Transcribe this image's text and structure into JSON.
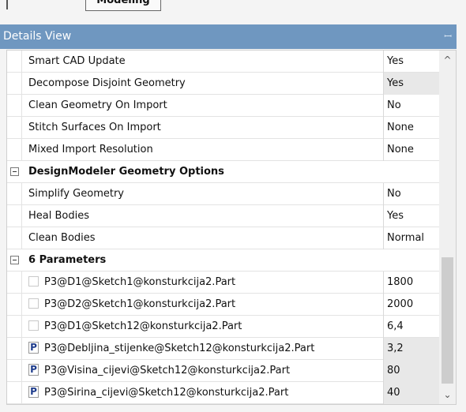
{
  "tabs": {
    "active_label": "Modeling"
  },
  "header": {
    "title": "Details View",
    "pin_glyph": "ꟷ"
  },
  "rows_top": [
    {
      "name": "Smart CAD Update",
      "value": "Yes",
      "highlight": false
    },
    {
      "name": "Decompose Disjoint Geometry",
      "value": "Yes",
      "highlight": true
    },
    {
      "name": "Clean Geometry On Import",
      "value": "No",
      "highlight": false
    },
    {
      "name": "Stitch Surfaces On Import",
      "value": "None",
      "highlight": false
    },
    {
      "name": "Mixed Import Resolution",
      "value": "None",
      "highlight": false
    }
  ],
  "group1": {
    "label": "DesignModeler Geometry Options"
  },
  "rows_mid": [
    {
      "name": "Simplify Geometry",
      "value": "No"
    },
    {
      "name": "Heal Bodies",
      "value": "Yes"
    },
    {
      "name": "Clean Bodies",
      "value": "Normal"
    }
  ],
  "group2": {
    "label": "6 Parameters"
  },
  "parameters": [
    {
      "name": "P3@D1@Sketch1@konsturkcija2.Part",
      "value": "1800",
      "driving": false
    },
    {
      "name": "P3@D2@Sketch1@konsturkcija2.Part",
      "value": "2000",
      "driving": false
    },
    {
      "name": "P3@D1@Sketch12@konsturkcija2.Part",
      "value": "6,4",
      "driving": false
    },
    {
      "name": "P3@Debljina_stijenke@Sketch12@konsturkcija2.Part",
      "value": "3,2",
      "driving": true
    },
    {
      "name": "P3@Visina_cijevi@Sketch12@konsturkcija2.Part",
      "value": "80",
      "driving": true
    },
    {
      "name": "P3@Sirina_cijevi@Sketch12@konsturkcija2.Part",
      "value": "40",
      "driving": true
    }
  ],
  "parameter_badge": "P",
  "scrollbar": {
    "up_glyph": "^",
    "down_glyph": "⌄"
  },
  "colors": {
    "header_bg": "#6f97c0",
    "value_highlight": "#e8e8e8"
  }
}
